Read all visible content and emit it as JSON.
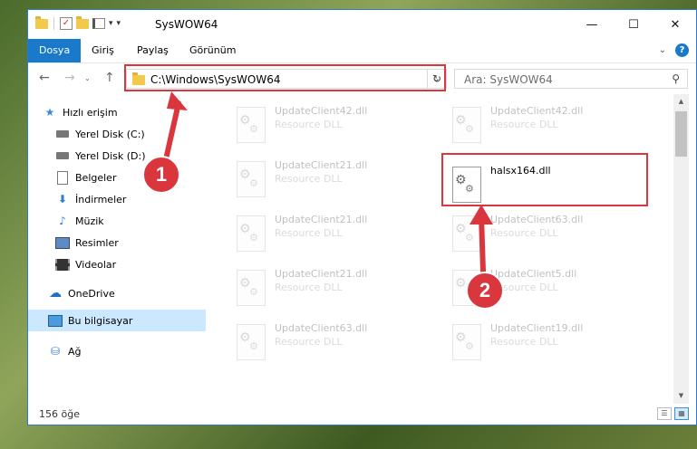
{
  "window": {
    "title": "SysWOW64",
    "controls": {
      "minimize": "—",
      "maximize": "☐",
      "close": "✕"
    }
  },
  "ribbon": {
    "tabs": [
      {
        "label": "Dosya",
        "active": true
      },
      {
        "label": "Giriş"
      },
      {
        "label": "Paylaş"
      },
      {
        "label": "Görünüm"
      }
    ]
  },
  "nav": {
    "address": "C:\\Windows\\SysWOW64",
    "search_placeholder": "Ara: SysWOW64"
  },
  "sidebar": {
    "quick_access": "Hızlı erişim",
    "items": [
      {
        "label": "Yerel Disk (C:)",
        "icon": "drive-icon",
        "pinned": true
      },
      {
        "label": "Yerel Disk (D:)",
        "icon": "drive-icon",
        "pinned": true
      },
      {
        "label": "Belgeler",
        "icon": "documents-icon",
        "pinned": true
      },
      {
        "label": "İndirmeler",
        "icon": "downloads-icon",
        "pinned": true
      },
      {
        "label": "Müzik",
        "icon": "music-icon",
        "pinned": true
      },
      {
        "label": "Resimler",
        "icon": "pictures-icon",
        "pinned": true
      },
      {
        "label": "Videolar",
        "icon": "videos-icon",
        "pinned": true
      }
    ],
    "onedrive": "OneDrive",
    "this_pc": "Bu bilgisayar",
    "network": "Ağ"
  },
  "files": {
    "type_label": "Resource DLL",
    "left_column": [
      "UpdateClient42.dll",
      "UpdateClient21.dll",
      "UpdateClient21.dll",
      "UpdateClient21.dll",
      "UpdateClient63.dll"
    ],
    "right_column": [
      "UpdateClient42.dll",
      "halsx164.dll",
      "UpdateClient63.dll",
      "UpdateClient5.dll",
      "UpdateClient19.dll"
    ],
    "highlighted": "halsx164.dll"
  },
  "status": {
    "item_count": "156 öğe"
  },
  "annotations": {
    "step1": "1",
    "step2": "2"
  },
  "colors": {
    "accent": "#1979ca",
    "annotation_red": "#d9363e",
    "selected_bg": "#cce8ff"
  }
}
